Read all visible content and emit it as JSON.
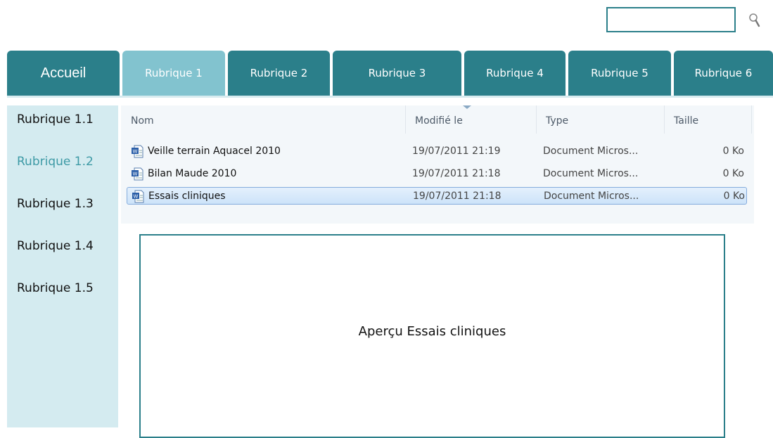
{
  "search": {
    "value": "",
    "icon": "search-icon"
  },
  "tabs": [
    {
      "label": "Accueil"
    },
    {
      "label": "Rubrique 1",
      "active": true
    },
    {
      "label": "Rubrique 2"
    },
    {
      "label": "Rubrique 3"
    },
    {
      "label": "Rubrique 4"
    },
    {
      "label": "Rubrique 5"
    },
    {
      "label": "Rubrique 6"
    }
  ],
  "sidebar": {
    "items": [
      {
        "label": "Rubrique 1.1"
      },
      {
        "label": "Rubrique 1.2",
        "active": true
      },
      {
        "label": "Rubrique 1.3"
      },
      {
        "label": "Rubrique 1.4"
      },
      {
        "label": "Rubrique 1.5"
      }
    ]
  },
  "explorer": {
    "columns": [
      "Nom",
      "Modifié le",
      "Type",
      "Taille"
    ],
    "sort_column": "Modifié le",
    "files": [
      {
        "name": "Veille terrain Aquacel 2010",
        "modified": "19/07/2011 21:19",
        "type": "Document Micros...",
        "size": "0 Ko",
        "icon": "word-document-icon"
      },
      {
        "name": "Bilan Maude 2010",
        "modified": "19/07/2011 21:18",
        "type": "Document Micros...",
        "size": "0 Ko",
        "icon": "word-document-icon"
      },
      {
        "name": "Essais cliniques",
        "modified": "19/07/2011 21:18",
        "type": "Document Micros...",
        "size": "0 Ko",
        "icon": "word-document-icon",
        "selected": true
      }
    ]
  },
  "preview": {
    "text": "Aperçu Essais cliniques"
  },
  "colors": {
    "primary": "#2b7f8a",
    "active_tab": "#82c3cf",
    "sidebar_bg": "#d4ebf0",
    "sidebar_active_text": "#3e9aa6",
    "selection_border": "#84acdd"
  }
}
